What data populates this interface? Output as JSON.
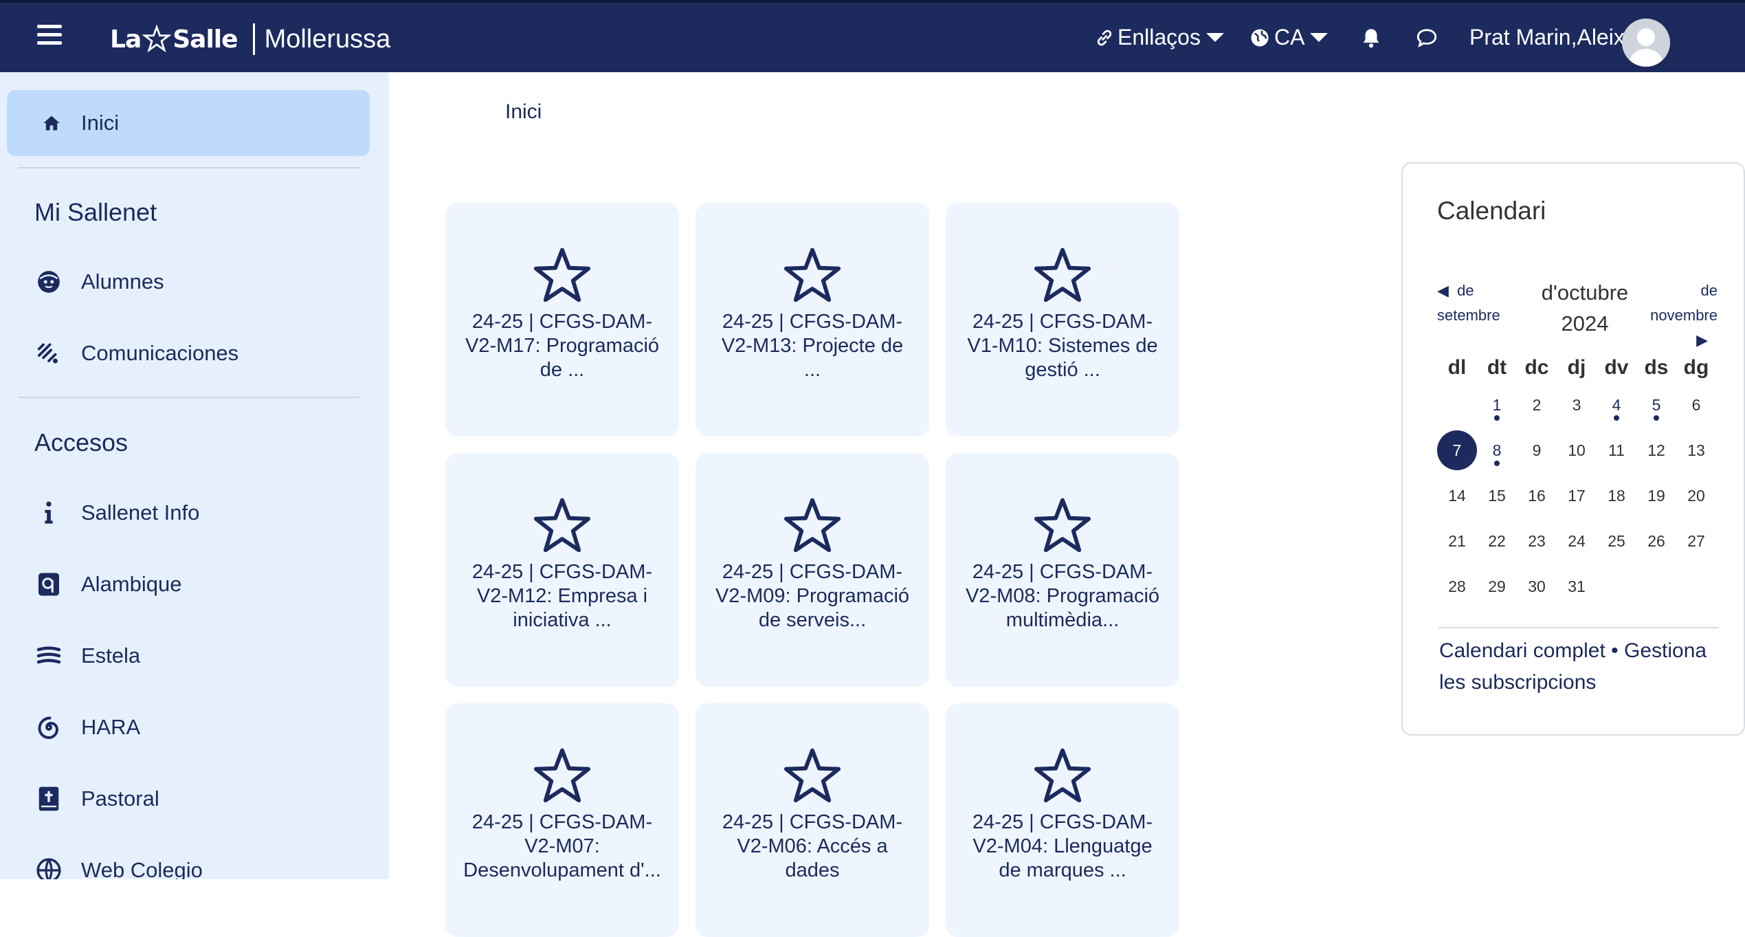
{
  "header": {
    "menu_icon": "hamburger-icon",
    "logo_left": "La",
    "logo_right": "Salle",
    "school": "Mollerussa",
    "links_label": "Enllaços",
    "lang_label": "CA",
    "user_name": "Prat Marin,Aleix",
    "brand_color": "#1c2a5e"
  },
  "sidebar": {
    "home": "Inici",
    "section1": "Mi Sallenet",
    "items1": [
      "Alumnes",
      "Comunicaciones"
    ],
    "section2": "Accesos",
    "items2": [
      "Sallenet Info",
      "Alambique",
      "Estela",
      "HARA",
      "Pastoral",
      "Web Colegio"
    ]
  },
  "breadcrumb": "Inici",
  "courses": [
    {
      "line1": "24-25 | CFGS-DAM-",
      "line2": "V2-M17: Programació",
      "line3": "de ..."
    },
    {
      "line1": "24-25 | CFGS-DAM-",
      "line2": "V2-M13: Projecte de",
      "line3": "..."
    },
    {
      "line1": "24-25 | CFGS-DAM-",
      "line2": "V1-M10: Sistemes de",
      "line3": "gestió ..."
    },
    {
      "line1": "24-25 | CFGS-DAM-",
      "line2": "V2-M12: Empresa i",
      "line3": "iniciativa ..."
    },
    {
      "line1": "24-25 | CFGS-DAM-",
      "line2": "V2-M09: Programació",
      "line3": "de serveis..."
    },
    {
      "line1": "24-25 | CFGS-DAM-",
      "line2": "V2-M08: Programació",
      "line3": "multimèdia..."
    },
    {
      "line1": "24-25 | CFGS-DAM-",
      "line2": "V2-M07:",
      "line3": "Desenvolupament d'..."
    },
    {
      "line1": "24-25 | CFGS-DAM-",
      "line2": "V2-M06: Accés a",
      "line3": "dades"
    },
    {
      "line1": "24-25 | CFGS-DAM-",
      "line2": "V2-M04: Llenguatge",
      "line3": "de marques ..."
    }
  ],
  "calendar": {
    "title": "Calendari",
    "prev_de": "de",
    "prev_month": "setembre",
    "next_de": "de",
    "next_month": "novembre",
    "month": "d'octubre",
    "year": "2024",
    "weekdays": [
      "dl",
      "dt",
      "dc",
      "dj",
      "dv",
      "ds",
      "dg"
    ],
    "weeks": [
      [
        "",
        "1",
        "2",
        "3",
        "4",
        "5",
        "6"
      ],
      [
        "7",
        "8",
        "9",
        "10",
        "11",
        "12",
        "13"
      ],
      [
        "14",
        "15",
        "16",
        "17",
        "18",
        "19",
        "20"
      ],
      [
        "21",
        "22",
        "23",
        "24",
        "25",
        "26",
        "27"
      ],
      [
        "28",
        "29",
        "30",
        "31",
        "",
        "",
        ""
      ]
    ],
    "event_days": [
      "1",
      "4",
      "5",
      "8"
    ],
    "today": "7",
    "footer_full": "Calendari complet",
    "footer_sep": " • ",
    "footer_manage_1": "Gestiona",
    "footer_manage_2": "les subscripcions"
  }
}
